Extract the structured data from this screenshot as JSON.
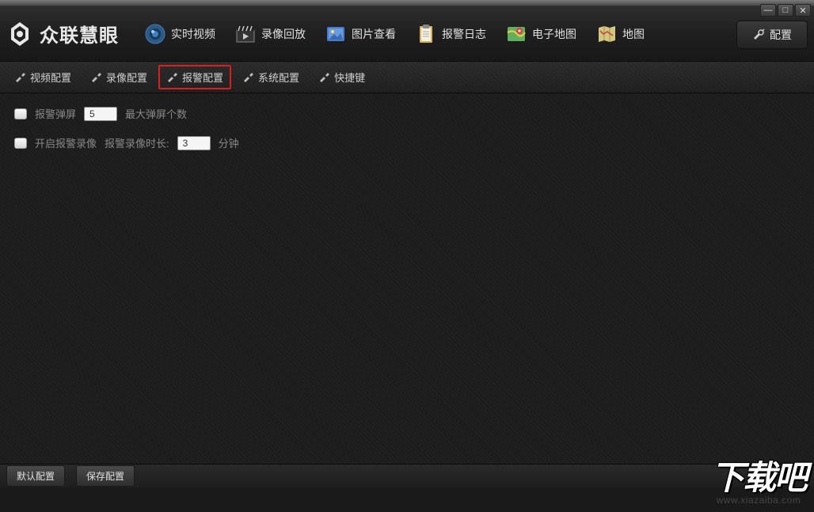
{
  "app": {
    "name": "众联慧眼"
  },
  "windowControls": {
    "minimize": "—",
    "maximize": "□",
    "close": "✕"
  },
  "topNav": {
    "items": [
      {
        "label": "实时视频",
        "icon": "camera"
      },
      {
        "label": "录像回放",
        "icon": "clapperboard"
      },
      {
        "label": "图片查看",
        "icon": "picture"
      },
      {
        "label": "报警日志",
        "icon": "clipboard"
      },
      {
        "label": "电子地图",
        "icon": "emap"
      },
      {
        "label": "地图",
        "icon": "map"
      }
    ],
    "configButton": "配置"
  },
  "subNav": {
    "items": [
      {
        "label": "视频配置",
        "active": false
      },
      {
        "label": "录像配置",
        "active": false
      },
      {
        "label": "报警配置",
        "active": true
      },
      {
        "label": "系统配置",
        "active": false
      },
      {
        "label": "快捷键",
        "active": false
      }
    ]
  },
  "form": {
    "row1": {
      "checkboxLabel": "报警弹屏",
      "inputValue": "5",
      "suffixLabel": "最大弹屏个数"
    },
    "row2": {
      "checkboxLabel": "开启报警录像",
      "prefixLabel": "报警录像时长:",
      "inputValue": "3",
      "suffixLabel": "分钟"
    }
  },
  "footer": {
    "defaultBtn": "默认配置",
    "saveBtn": "保存配置"
  },
  "watermark": {
    "main": "下载吧",
    "url": "www.xiazaiba.com"
  }
}
